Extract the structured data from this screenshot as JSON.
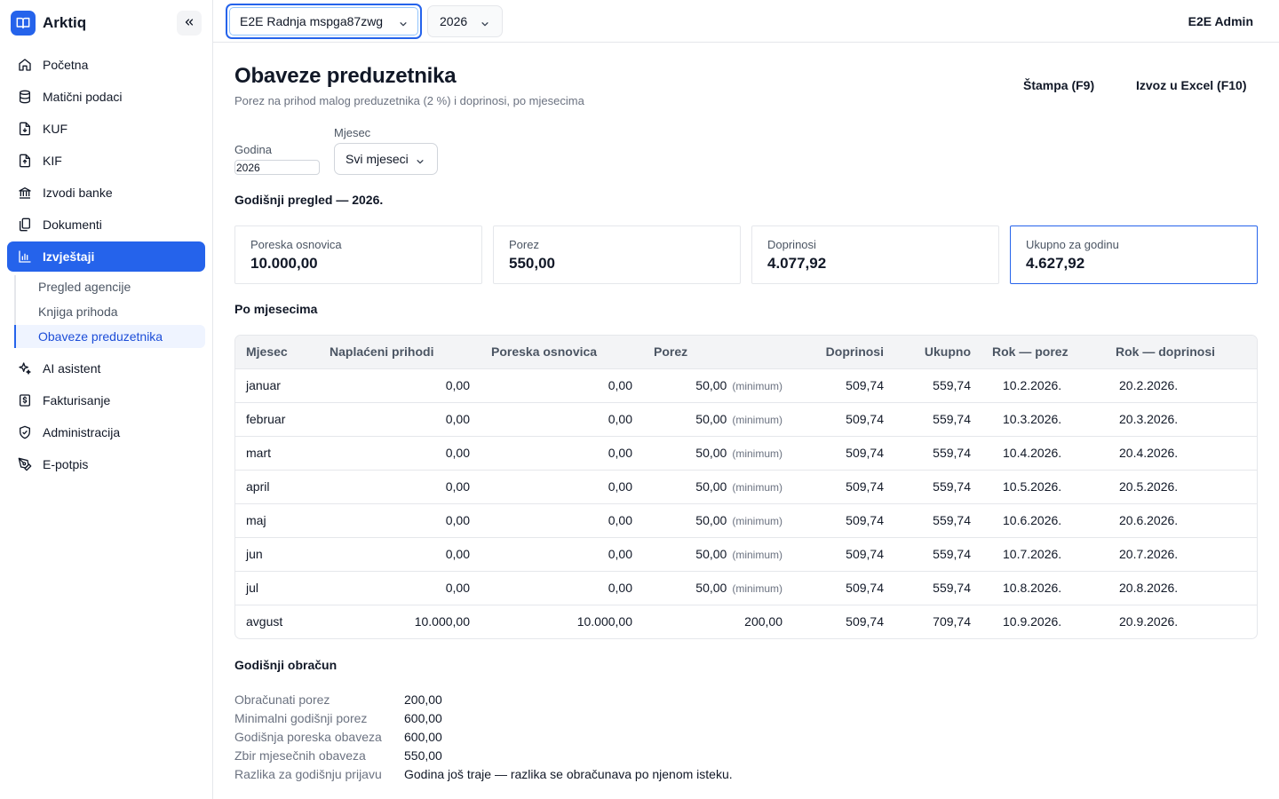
{
  "app": {
    "name": "Arktiq",
    "colors": {
      "accent": "#2563eb"
    }
  },
  "sidebar": {
    "items": [
      {
        "label": "Početna",
        "icon": "home-icon"
      },
      {
        "label": "Matični podaci",
        "icon": "database-icon"
      },
      {
        "label": "KUF",
        "icon": "file-download-icon"
      },
      {
        "label": "KIF",
        "icon": "file-upload-icon"
      },
      {
        "label": "Izvodi banke",
        "icon": "bank-icon"
      },
      {
        "label": "Dokumenti",
        "icon": "documents-icon"
      },
      {
        "label": "Izvještaji",
        "icon": "bar-chart-icon",
        "active": true
      },
      {
        "label": "AI asistent",
        "icon": "sparkle-icon"
      },
      {
        "label": "Fakturisanje",
        "icon": "dollar-receipt-icon"
      },
      {
        "label": "Administracija",
        "icon": "shield-icon"
      },
      {
        "label": "E-potpis",
        "icon": "pen-nib-icon"
      }
    ],
    "subitems": [
      {
        "label": "Pregled agencije"
      },
      {
        "label": "Knjiga prihoda"
      },
      {
        "label": "Obaveze preduzetnika",
        "active": true
      }
    ]
  },
  "topbar": {
    "company": "E2E Radnja mspga87zwg",
    "year": "2026",
    "user": "E2E Admin"
  },
  "page": {
    "title": "Obaveze preduzetnika",
    "subtitle": "Porez na prihod malog preduzetnika (2 %) i doprinosi, po mjesecima",
    "print_label": "Štampa (F9)",
    "excel_label": "Izvoz u Excel (F10)"
  },
  "filters": {
    "year_label": "Godina",
    "year_value": "2026",
    "month_label": "Mjesec",
    "month_value": "Svi mjeseci"
  },
  "annual": {
    "heading": "Godišnji pregled — 2026.",
    "cards": [
      {
        "label": "Poreska osnovica",
        "value": "10.000,00"
      },
      {
        "label": "Porez",
        "value": "550,00"
      },
      {
        "label": "Doprinosi",
        "value": "4.077,92"
      },
      {
        "label": "Ukupno za godinu",
        "value": "4.627,92"
      }
    ]
  },
  "monthly": {
    "heading": "Po mjesecima",
    "columns": [
      "Mjesec",
      "Naplaćeni prihodi",
      "Poreska osnovica",
      "Porez",
      "Doprinosi",
      "Ukupno",
      "Rok — porez",
      "Rok — doprinosi"
    ],
    "rows": [
      {
        "month": "januar",
        "income": "0,00",
        "base": "0,00",
        "tax": "50,00",
        "note": "(minimum)",
        "contrib": "509,74",
        "total": "559,74",
        "due_tax": "10.2.2026.",
        "due_contrib": "20.2.2026."
      },
      {
        "month": "februar",
        "income": "0,00",
        "base": "0,00",
        "tax": "50,00",
        "note": "(minimum)",
        "contrib": "509,74",
        "total": "559,74",
        "due_tax": "10.3.2026.",
        "due_contrib": "20.3.2026."
      },
      {
        "month": "mart",
        "income": "0,00",
        "base": "0,00",
        "tax": "50,00",
        "note": "(minimum)",
        "contrib": "509,74",
        "total": "559,74",
        "due_tax": "10.4.2026.",
        "due_contrib": "20.4.2026."
      },
      {
        "month": "april",
        "income": "0,00",
        "base": "0,00",
        "tax": "50,00",
        "note": "(minimum)",
        "contrib": "509,74",
        "total": "559,74",
        "due_tax": "10.5.2026.",
        "due_contrib": "20.5.2026."
      },
      {
        "month": "maj",
        "income": "0,00",
        "base": "0,00",
        "tax": "50,00",
        "note": "(minimum)",
        "contrib": "509,74",
        "total": "559,74",
        "due_tax": "10.6.2026.",
        "due_contrib": "20.6.2026."
      },
      {
        "month": "jun",
        "income": "0,00",
        "base": "0,00",
        "tax": "50,00",
        "note": "(minimum)",
        "contrib": "509,74",
        "total": "559,74",
        "due_tax": "10.7.2026.",
        "due_contrib": "20.7.2026."
      },
      {
        "month": "jul",
        "income": "0,00",
        "base": "0,00",
        "tax": "50,00",
        "note": "(minimum)",
        "contrib": "509,74",
        "total": "559,74",
        "due_tax": "10.8.2026.",
        "due_contrib": "20.8.2026."
      },
      {
        "month": "avgust",
        "income": "10.000,00",
        "base": "10.000,00",
        "tax": "200,00",
        "note": "",
        "contrib": "509,74",
        "total": "709,74",
        "due_tax": "10.9.2026.",
        "due_contrib": "20.9.2026."
      }
    ]
  },
  "settlement": {
    "heading": "Godišnji obračun",
    "rows": [
      {
        "label": "Obračunati porez",
        "value": "200,00"
      },
      {
        "label": "Minimalni godišnji porez",
        "value": "600,00"
      },
      {
        "label": "Godišnja poreska obaveza",
        "value": "600,00"
      },
      {
        "label": "Zbir mjesečnih obaveza",
        "value": "550,00"
      },
      {
        "label": "Razlika za godišnju prijavu",
        "value": "Godina još traje — razlika se obračunava po njenom isteku."
      }
    ]
  }
}
